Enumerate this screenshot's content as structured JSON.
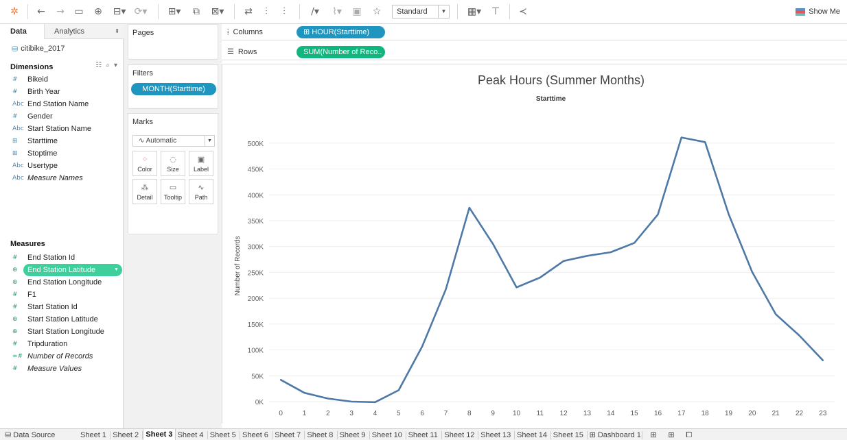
{
  "toolbar": {
    "mark_type_select": "Standard",
    "show_me_label": "Show Me"
  },
  "datapane": {
    "tabs": {
      "data": "Data",
      "analytics": "Analytics"
    },
    "datasource": "citibike_2017",
    "dimensions_header": "Dimensions",
    "dimensions": [
      {
        "icon": "#",
        "label": "Bikeid",
        "italic": false
      },
      {
        "icon": "#",
        "label": "Birth Year",
        "italic": false
      },
      {
        "icon": "Abc",
        "label": "End Station Name",
        "italic": false
      },
      {
        "icon": "#",
        "label": "Gender",
        "italic": false
      },
      {
        "icon": "Abc",
        "label": "Start Station Name",
        "italic": false
      },
      {
        "icon": "date",
        "label": "Starttime",
        "italic": false
      },
      {
        "icon": "date",
        "label": "Stoptime",
        "italic": false
      },
      {
        "icon": "Abc",
        "label": "Usertype",
        "italic": false
      },
      {
        "icon": "Abc",
        "label": "Measure Names",
        "italic": true
      }
    ],
    "measures_header": "Measures",
    "measures": [
      {
        "icon": "#",
        "label": "End Station Id",
        "italic": false
      },
      {
        "icon": "globe",
        "label": "End Station Latitude",
        "italic": false,
        "selected": true
      },
      {
        "icon": "globe",
        "label": "End Station Longitude",
        "italic": false
      },
      {
        "icon": "#",
        "label": "F1",
        "italic": false
      },
      {
        "icon": "#",
        "label": "Start Station Id",
        "italic": false
      },
      {
        "icon": "globe",
        "label": "Start Station Latitude",
        "italic": false
      },
      {
        "icon": "globe",
        "label": "Start Station Longitude",
        "italic": false
      },
      {
        "icon": "#",
        "label": "Tripduration",
        "italic": false
      },
      {
        "icon": "=#",
        "label": "Number of Records",
        "italic": true
      },
      {
        "icon": "#",
        "label": "Measure Values",
        "italic": true
      }
    ]
  },
  "cards": {
    "pages_title": "Pages",
    "filters_title": "Filters",
    "filter_pill": "MONTH(Starttime)",
    "marks_title": "Marks",
    "marks_type": "Automatic",
    "mark_buttons": [
      {
        "label": "Color",
        "icon": "color-icon"
      },
      {
        "label": "Size",
        "icon": "size-icon"
      },
      {
        "label": "Label",
        "icon": "label-icon"
      },
      {
        "label": "Detail",
        "icon": "detail-icon"
      },
      {
        "label": "Tooltip",
        "icon": "tooltip-icon"
      },
      {
        "label": "Path",
        "icon": "path-icon"
      }
    ]
  },
  "shelves": {
    "columns_label": "Columns",
    "columns_pill": "⊞ HOUR(Starttime)",
    "rows_label": "Rows",
    "rows_pill": "SUM(Number of Reco.."
  },
  "chart_data": {
    "type": "line",
    "title": "Peak Hours (Summer Months)",
    "subtitle": "Starttime",
    "xlabel": "",
    "ylabel": "Number of Records",
    "x": [
      0,
      1,
      2,
      3,
      4,
      5,
      6,
      7,
      8,
      9,
      10,
      11,
      12,
      13,
      14,
      15,
      16,
      17,
      18,
      19,
      20,
      21,
      22,
      23
    ],
    "y_ticks": [
      "0K",
      "50K",
      "100K",
      "150K",
      "200K",
      "250K",
      "300K",
      "350K",
      "400K",
      "450K",
      "500K"
    ],
    "ylim": [
      0,
      525000
    ],
    "series": [
      {
        "values": [
          42000,
          17000,
          6000,
          0,
          -1000,
          22000,
          107000,
          217000,
          375000,
          305000,
          221000,
          240000,
          272000,
          282000,
          289000,
          307000,
          362000,
          511000,
          502000,
          363000,
          251000,
          169000,
          128000,
          80000
        ]
      }
    ],
    "grid": true,
    "line_color": "#4e79a7"
  },
  "sheets": {
    "data_source": "Data Source",
    "tabs": [
      "Sheet 1",
      "Sheet 2",
      "Sheet 3",
      "Sheet 4",
      "Sheet 5",
      "Sheet 6",
      "Sheet 7",
      "Sheet 8",
      "Sheet 9",
      "Sheet 10",
      "Sheet 11",
      "Sheet 12",
      "Sheet 13",
      "Sheet 14",
      "Sheet 15",
      "⊞ Dashboard 1"
    ],
    "active_index": 2
  }
}
